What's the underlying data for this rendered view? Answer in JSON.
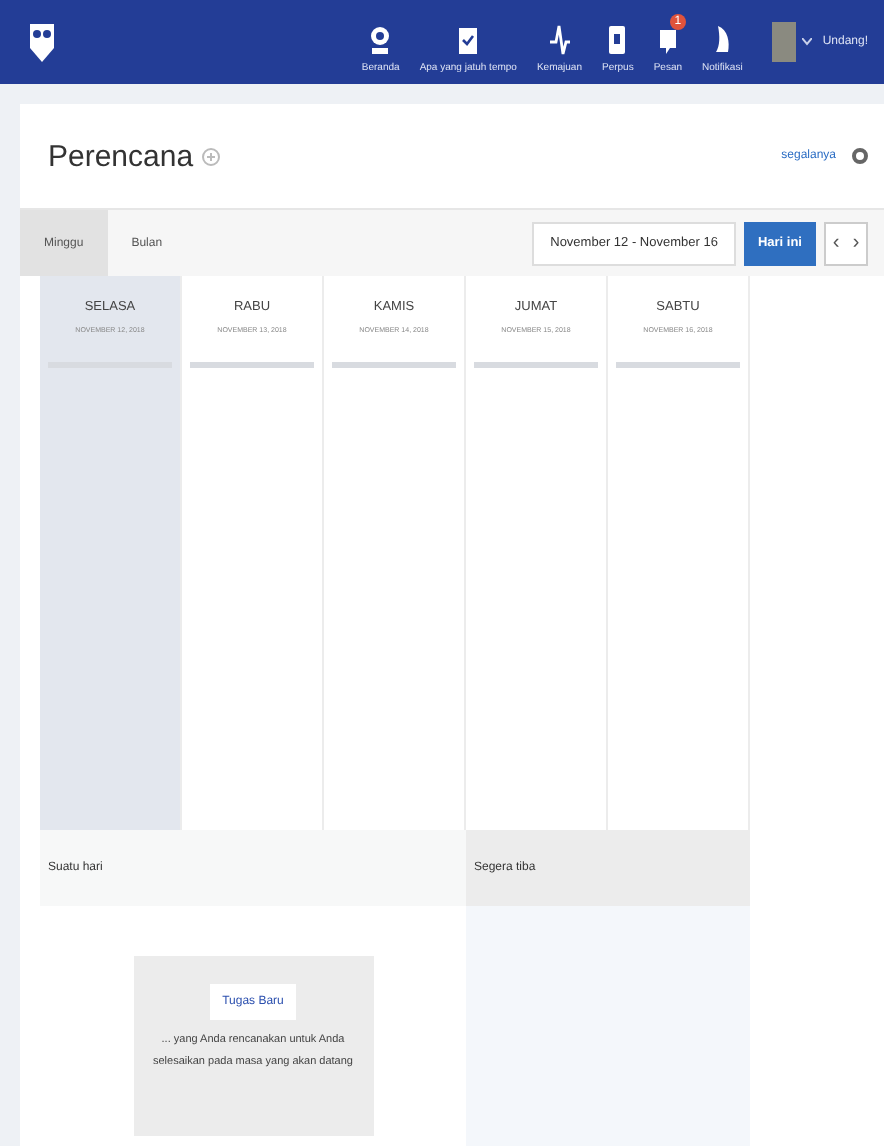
{
  "nav": {
    "items": [
      {
        "label": "Beranda"
      },
      {
        "label": "Apa yang jatuh tempo"
      },
      {
        "label": "Kemajuan"
      },
      {
        "label": "Perpus"
      },
      {
        "label": "Pesan",
        "badge": "1"
      },
      {
        "label": "Notifikasi"
      }
    ],
    "invite": "Undang!"
  },
  "planner": {
    "title": "Perencana",
    "all_link": "segalanya",
    "views": [
      {
        "label": "Minggu",
        "selected": true
      },
      {
        "label": "Bulan",
        "selected": false
      }
    ],
    "range": "November 12 - November 16",
    "today": "Hari ini",
    "prev": "‹",
    "next": "›",
    "days": [
      {
        "name": "SELASA",
        "date": "NOVEMBER 12, 2018",
        "selected": true
      },
      {
        "name": "RABU",
        "date": "NOVEMBER 13, 2018",
        "selected": false
      },
      {
        "name": "KAMIS",
        "date": "NOVEMBER 14, 2018",
        "selected": false
      },
      {
        "name": "JUMAT",
        "date": "NOVEMBER 15, 2018",
        "selected": false
      },
      {
        "name": "SABTU",
        "date": "NOVEMBER 16, 2018",
        "selected": false
      }
    ],
    "someday": {
      "title": "Suatu hari",
      "button": "Tugas Baru",
      "note": "... yang Anda rencanakan untuk Anda selesaikan pada masa yang akan datang"
    },
    "upcoming": {
      "title": "Segera tiba"
    }
  }
}
